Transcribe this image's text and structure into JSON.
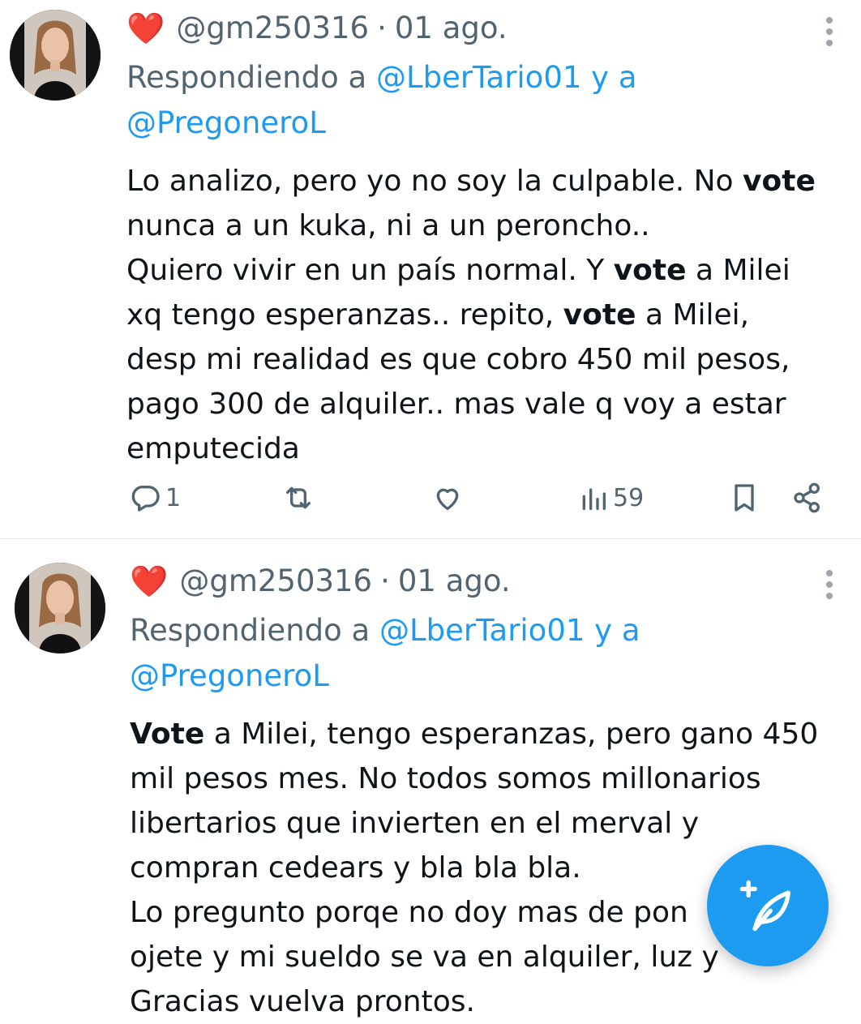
{
  "tweets": [
    {
      "heart": "❤️",
      "handle": "@gm250316",
      "separator": "·",
      "date": "01 ago.",
      "reply_prefix": "Respondiendo a",
      "reply_mention1": "@LberTario01",
      "reply_joiner": "y a",
      "reply_mention2": "@PregoneroL",
      "text_parts": {
        "p1": "Lo analizo, pero yo no soy la culpable. No ",
        "b1": "vote",
        "p2": "nunca a un kuka, ni a un peroncho..",
        "p3": "Quiero vivir en un país normal. Y ",
        "b2": "vote",
        "p4": " a Milei",
        "p5": "xq tengo esperanzas.. repito, ",
        "b3": "vote",
        "p6": " a Milei,",
        "p7": "desp mi realidad es que cobro 450 mil pesos,",
        "p8": "pago 300 de alquiler.. mas vale q voy a estar",
        "p9": "emputecida"
      },
      "actions": {
        "reply_count": "1",
        "views_count": "59"
      },
      "icons": [
        "reply-icon",
        "retweet-icon",
        "like-icon",
        "views-icon",
        "bookmark-icon",
        "share-icon",
        "more-icon",
        "heart-emoji"
      ]
    },
    {
      "heart": "❤️",
      "handle": "@gm250316",
      "separator": "·",
      "date": "01 ago.",
      "reply_prefix": "Respondiendo a",
      "reply_mention1": "@LberTario01",
      "reply_joiner": "y a",
      "reply_mention2": "@PregoneroL",
      "text_parts": {
        "b1": "Vote",
        "p1": " a Milei, tengo esperanzas, pero gano 450",
        "p2": "mil pesos mes. No todos somos millonarios",
        "p3": "libertarios que invierten en el merval y",
        "p4": "compran cedears y bla bla bla.",
        "p5": "Lo pregunto porqe no doy mas de pon",
        "p6": "ojete y mi sueldo se va en alquiler, luz y",
        "p7": "Gracias vuelva prontos."
      }
    }
  ],
  "fab": {
    "icon": "compose-tweet-icon"
  },
  "colors": {
    "accent": "#1d9bf0",
    "secondary_text": "#536471",
    "primary_text": "#0f1419",
    "heart": "#e0245e"
  }
}
